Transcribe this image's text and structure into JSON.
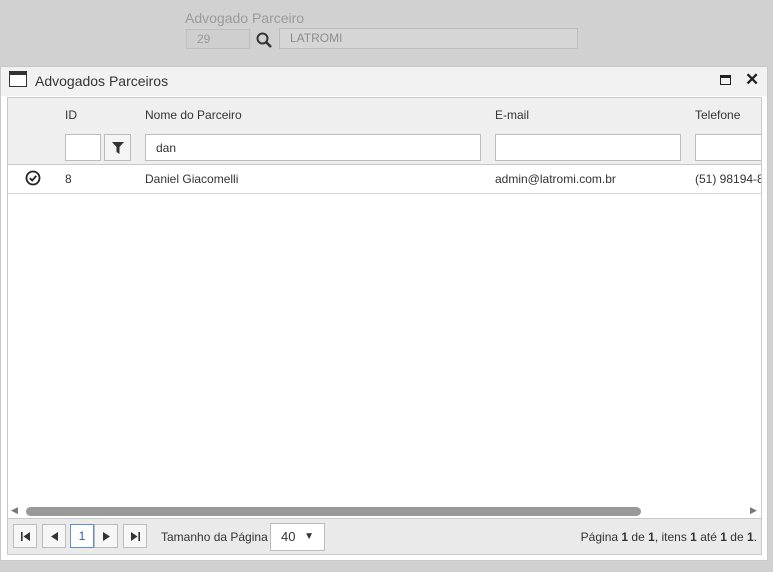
{
  "background_form": {
    "label": "Advogado Parceiro",
    "id_value": "29",
    "name_value": "LATROMI"
  },
  "dialog": {
    "title": "Advogados Parceiros",
    "columns": [
      "ID",
      "Nome do Parceiro",
      "E-mail",
      "Telefone"
    ],
    "filters": {
      "id": "",
      "name": "dan",
      "email": "",
      "phone": ""
    },
    "rows": [
      {
        "id": "8",
        "name": "Daniel Giacomelli",
        "email": "admin@latromi.com.br",
        "phone": "(51) 98194-8"
      }
    ]
  },
  "pager": {
    "current_page": "1",
    "page_size_label": "Tamanho da Página",
    "page_size": "40",
    "info": {
      "w1": "Página",
      "page": "1",
      "w2": "de",
      "pages": "1",
      "w3": ", itens",
      "from": "1",
      "w4": "até",
      "to": "1",
      "w5": "de",
      "total": "1",
      "end": "."
    }
  }
}
